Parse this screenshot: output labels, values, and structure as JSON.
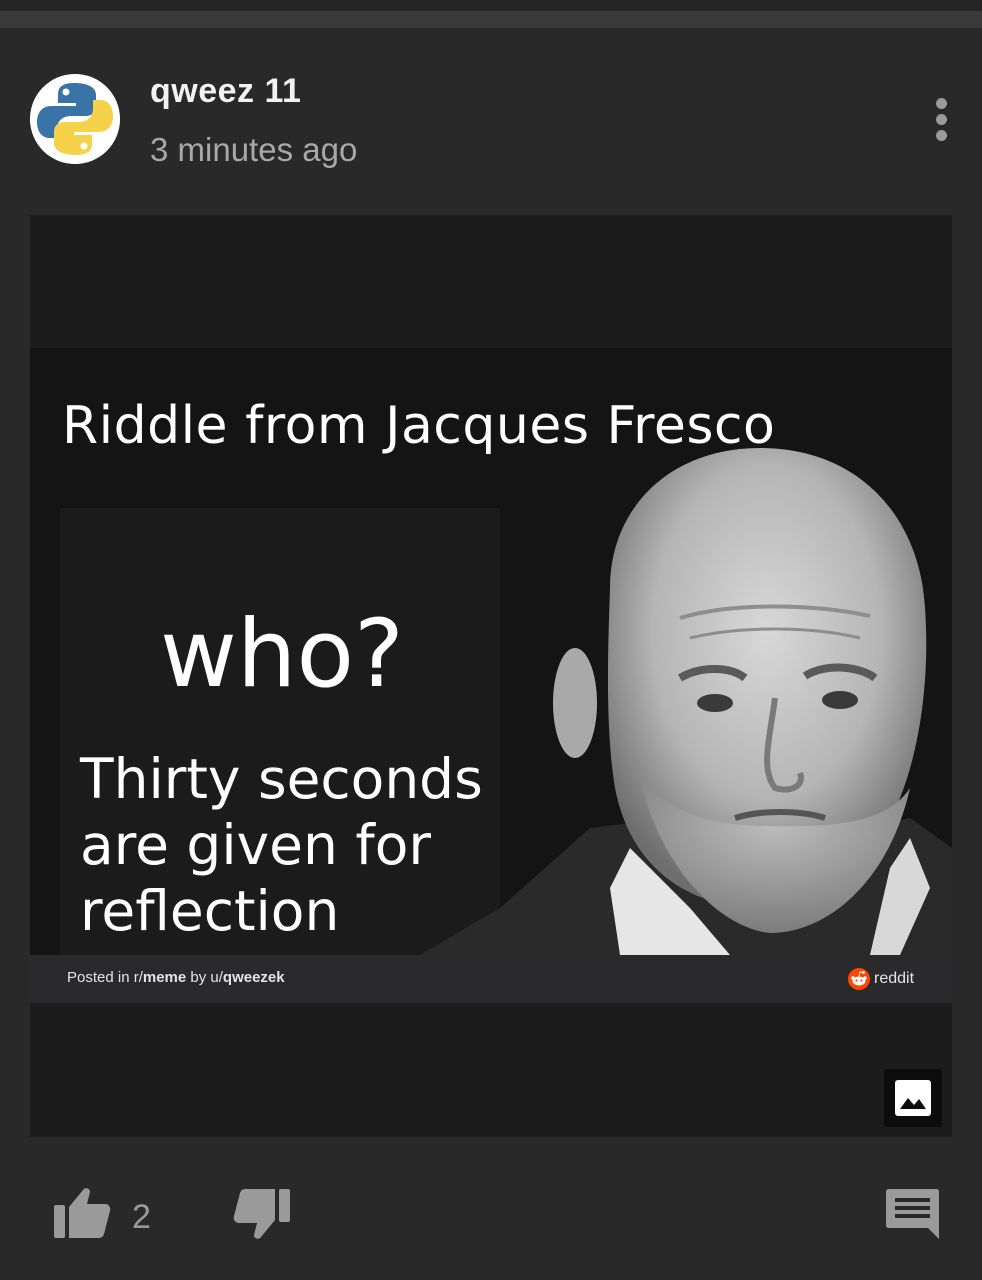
{
  "post": {
    "author": "qweez 11",
    "time_ago": "3 minutes ago",
    "avatar_icon": "python-logo-icon",
    "menu_icon": "more-vertical-icon"
  },
  "meme": {
    "title": "Riddle from Jacques Fresco",
    "question": "who?",
    "subtitle_lines": [
      "Thirty seconds",
      "are given for",
      "reflection"
    ]
  },
  "attribution": {
    "prefix": "Posted in r/",
    "subreddit": "meme",
    "by": " by u/",
    "user": "qweezek",
    "brand": "reddit"
  },
  "actions": {
    "like_icon": "thumb-up-icon",
    "like_count": "2",
    "dislike_icon": "thumb-down-icon",
    "comment_icon": "comment-icon",
    "image_icon": "image-icon"
  },
  "colors": {
    "background": "#282828",
    "text_primary": "#f2f2f2",
    "text_secondary": "#a8a8a8",
    "icon": "#9a9a9a",
    "reddit_orange": "#ff4500"
  }
}
